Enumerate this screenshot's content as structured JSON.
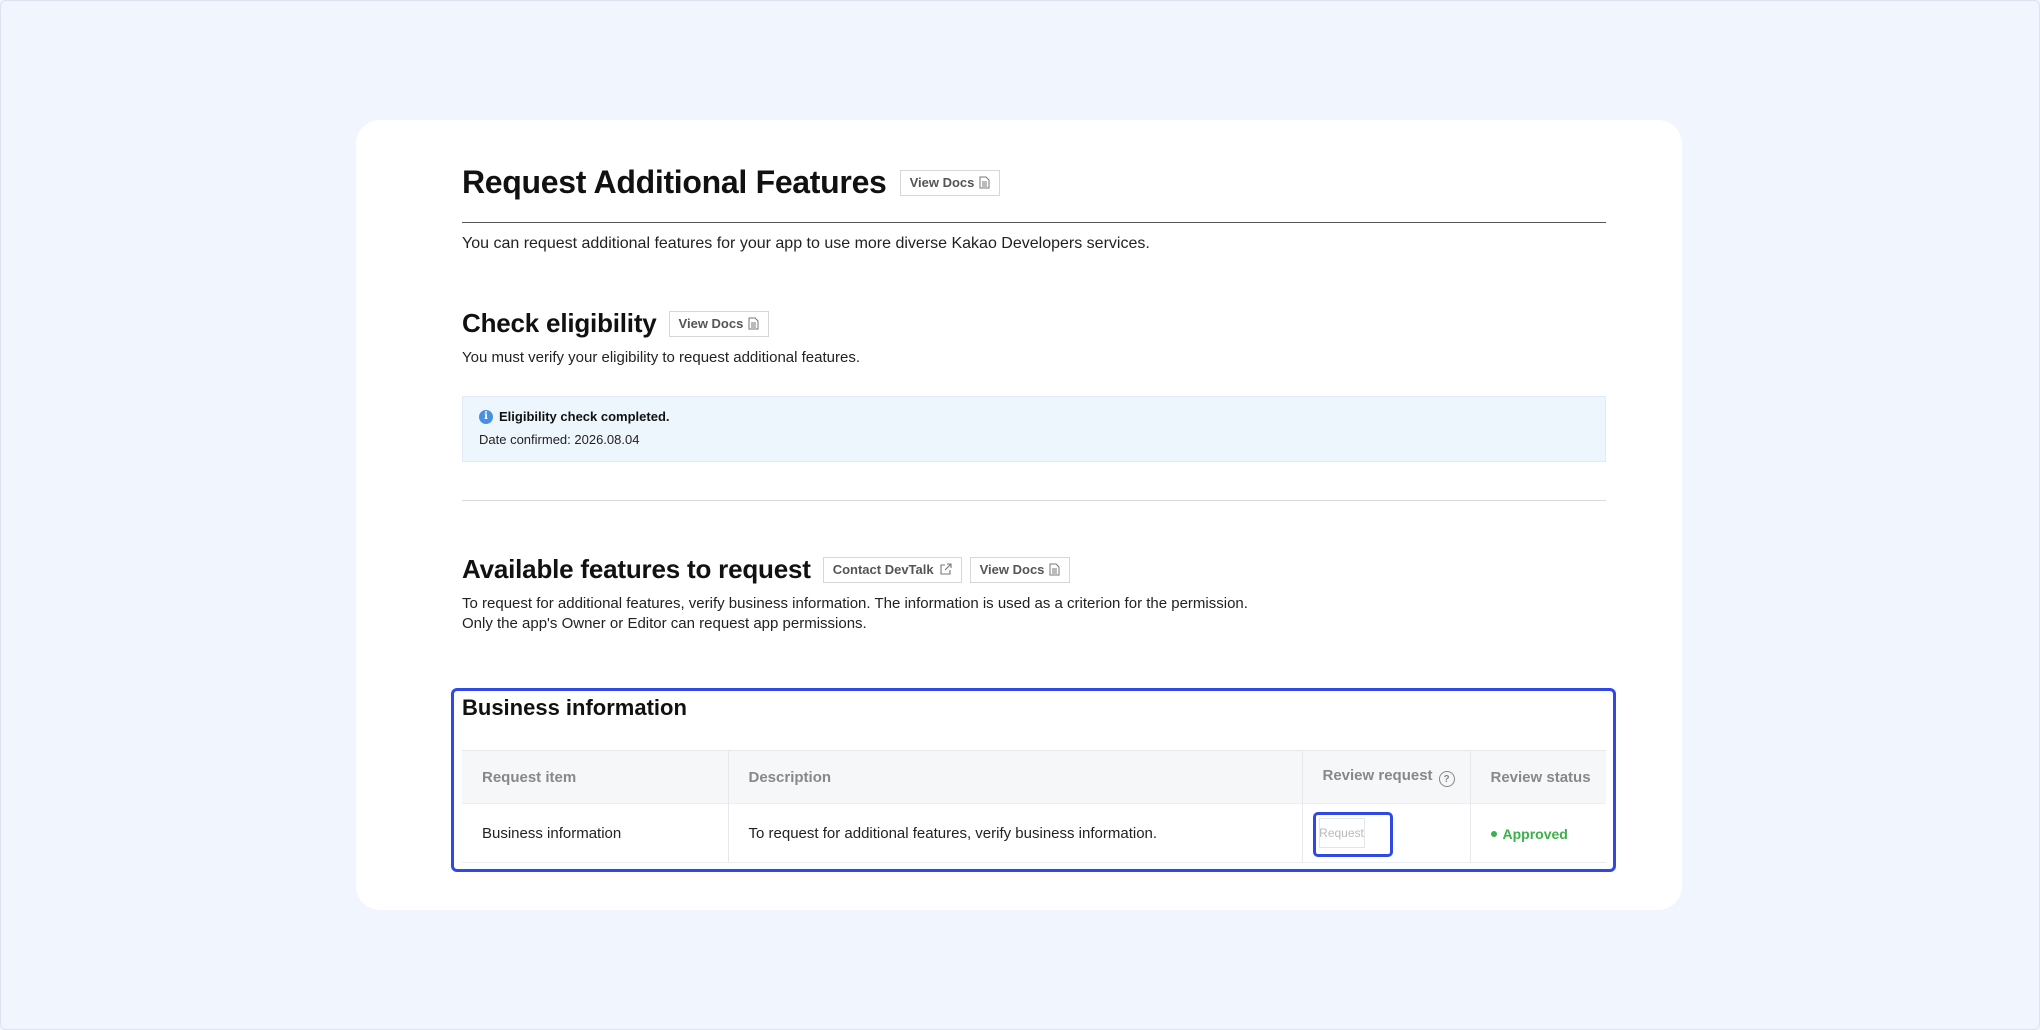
{
  "page": {
    "title": "Request Additional Features",
    "view_docs": "View Docs",
    "intro": "You can request additional features for your app to use more diverse Kakao Developers services."
  },
  "eligibility": {
    "title": "Check eligibility",
    "view_docs": "View Docs",
    "description": "You must verify your eligibility to request additional features.",
    "notice_title": "Eligibility check completed.",
    "notice_date": "Date confirmed: 2026.08.04",
    "notice_icon": "info-icon"
  },
  "available": {
    "title": "Available features to request",
    "contact_devtalk": "Contact DevTalk",
    "view_docs": "View Docs",
    "line1": "To request for additional features, verify business information. The information is used as a criterion for the permission.",
    "line2": "Only the app's Owner or Editor can request app permissions."
  },
  "business": {
    "title": "Business information",
    "columns": [
      "Request item",
      "Description",
      "Review request",
      "Review status"
    ],
    "rows": [
      {
        "item": "Business information",
        "description": "To request for additional features, verify business information.",
        "button": "Request",
        "status": "Approved"
      }
    ]
  },
  "colors": {
    "highlight": "#2f49e6",
    "approved": "#3cb04a",
    "notice_bg": "#eef6fd"
  }
}
